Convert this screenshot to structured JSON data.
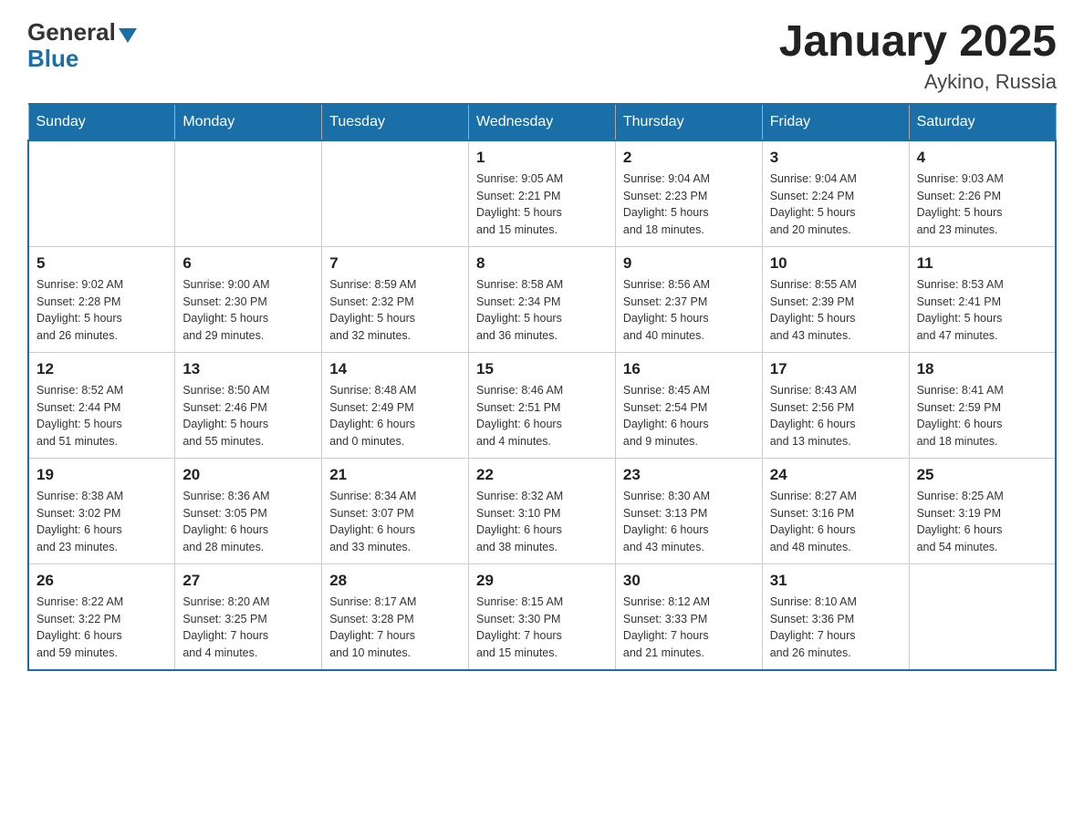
{
  "header": {
    "title": "January 2025",
    "subtitle": "Aykino, Russia"
  },
  "logo": {
    "general": "General",
    "blue": "Blue"
  },
  "days": [
    "Sunday",
    "Monday",
    "Tuesday",
    "Wednesday",
    "Thursday",
    "Friday",
    "Saturday"
  ],
  "weeks": [
    [
      {
        "day": "",
        "info": ""
      },
      {
        "day": "",
        "info": ""
      },
      {
        "day": "",
        "info": ""
      },
      {
        "day": "1",
        "info": "Sunrise: 9:05 AM\nSunset: 2:21 PM\nDaylight: 5 hours\nand 15 minutes."
      },
      {
        "day": "2",
        "info": "Sunrise: 9:04 AM\nSunset: 2:23 PM\nDaylight: 5 hours\nand 18 minutes."
      },
      {
        "day": "3",
        "info": "Sunrise: 9:04 AM\nSunset: 2:24 PM\nDaylight: 5 hours\nand 20 minutes."
      },
      {
        "day": "4",
        "info": "Sunrise: 9:03 AM\nSunset: 2:26 PM\nDaylight: 5 hours\nand 23 minutes."
      }
    ],
    [
      {
        "day": "5",
        "info": "Sunrise: 9:02 AM\nSunset: 2:28 PM\nDaylight: 5 hours\nand 26 minutes."
      },
      {
        "day": "6",
        "info": "Sunrise: 9:00 AM\nSunset: 2:30 PM\nDaylight: 5 hours\nand 29 minutes."
      },
      {
        "day": "7",
        "info": "Sunrise: 8:59 AM\nSunset: 2:32 PM\nDaylight: 5 hours\nand 32 minutes."
      },
      {
        "day": "8",
        "info": "Sunrise: 8:58 AM\nSunset: 2:34 PM\nDaylight: 5 hours\nand 36 minutes."
      },
      {
        "day": "9",
        "info": "Sunrise: 8:56 AM\nSunset: 2:37 PM\nDaylight: 5 hours\nand 40 minutes."
      },
      {
        "day": "10",
        "info": "Sunrise: 8:55 AM\nSunset: 2:39 PM\nDaylight: 5 hours\nand 43 minutes."
      },
      {
        "day": "11",
        "info": "Sunrise: 8:53 AM\nSunset: 2:41 PM\nDaylight: 5 hours\nand 47 minutes."
      }
    ],
    [
      {
        "day": "12",
        "info": "Sunrise: 8:52 AM\nSunset: 2:44 PM\nDaylight: 5 hours\nand 51 minutes."
      },
      {
        "day": "13",
        "info": "Sunrise: 8:50 AM\nSunset: 2:46 PM\nDaylight: 5 hours\nand 55 minutes."
      },
      {
        "day": "14",
        "info": "Sunrise: 8:48 AM\nSunset: 2:49 PM\nDaylight: 6 hours\nand 0 minutes."
      },
      {
        "day": "15",
        "info": "Sunrise: 8:46 AM\nSunset: 2:51 PM\nDaylight: 6 hours\nand 4 minutes."
      },
      {
        "day": "16",
        "info": "Sunrise: 8:45 AM\nSunset: 2:54 PM\nDaylight: 6 hours\nand 9 minutes."
      },
      {
        "day": "17",
        "info": "Sunrise: 8:43 AM\nSunset: 2:56 PM\nDaylight: 6 hours\nand 13 minutes."
      },
      {
        "day": "18",
        "info": "Sunrise: 8:41 AM\nSunset: 2:59 PM\nDaylight: 6 hours\nand 18 minutes."
      }
    ],
    [
      {
        "day": "19",
        "info": "Sunrise: 8:38 AM\nSunset: 3:02 PM\nDaylight: 6 hours\nand 23 minutes."
      },
      {
        "day": "20",
        "info": "Sunrise: 8:36 AM\nSunset: 3:05 PM\nDaylight: 6 hours\nand 28 minutes."
      },
      {
        "day": "21",
        "info": "Sunrise: 8:34 AM\nSunset: 3:07 PM\nDaylight: 6 hours\nand 33 minutes."
      },
      {
        "day": "22",
        "info": "Sunrise: 8:32 AM\nSunset: 3:10 PM\nDaylight: 6 hours\nand 38 minutes."
      },
      {
        "day": "23",
        "info": "Sunrise: 8:30 AM\nSunset: 3:13 PM\nDaylight: 6 hours\nand 43 minutes."
      },
      {
        "day": "24",
        "info": "Sunrise: 8:27 AM\nSunset: 3:16 PM\nDaylight: 6 hours\nand 48 minutes."
      },
      {
        "day": "25",
        "info": "Sunrise: 8:25 AM\nSunset: 3:19 PM\nDaylight: 6 hours\nand 54 minutes."
      }
    ],
    [
      {
        "day": "26",
        "info": "Sunrise: 8:22 AM\nSunset: 3:22 PM\nDaylight: 6 hours\nand 59 minutes."
      },
      {
        "day": "27",
        "info": "Sunrise: 8:20 AM\nSunset: 3:25 PM\nDaylight: 7 hours\nand 4 minutes."
      },
      {
        "day": "28",
        "info": "Sunrise: 8:17 AM\nSunset: 3:28 PM\nDaylight: 7 hours\nand 10 minutes."
      },
      {
        "day": "29",
        "info": "Sunrise: 8:15 AM\nSunset: 3:30 PM\nDaylight: 7 hours\nand 15 minutes."
      },
      {
        "day": "30",
        "info": "Sunrise: 8:12 AM\nSunset: 3:33 PM\nDaylight: 7 hours\nand 21 minutes."
      },
      {
        "day": "31",
        "info": "Sunrise: 8:10 AM\nSunset: 3:36 PM\nDaylight: 7 hours\nand 26 minutes."
      },
      {
        "day": "",
        "info": ""
      }
    ]
  ]
}
